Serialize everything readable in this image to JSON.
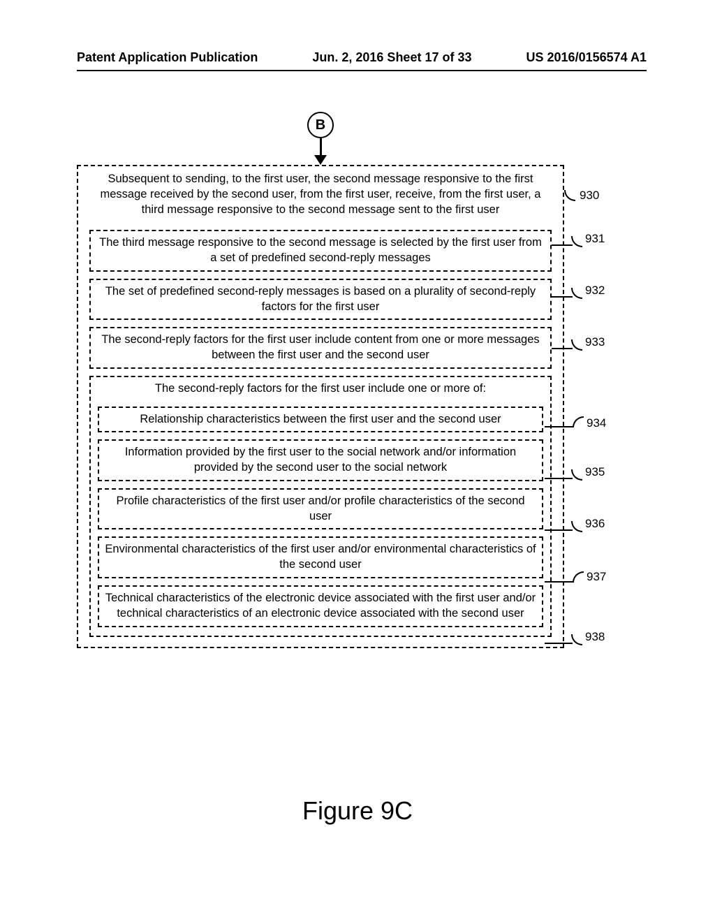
{
  "header": {
    "left": "Patent Application Publication",
    "center": "Jun. 2, 2016  Sheet 17 of 33",
    "right": "US 2016/0156574 A1"
  },
  "connector": {
    "label": "B"
  },
  "outer": {
    "text": "Subsequent to sending, to the first user, the second message responsive to the first message received by the second user, from the first user, receive, from the first user, a third message responsive to the second message sent to the first user",
    "ref": "930"
  },
  "inner": [
    {
      "text": "The third message responsive to the second message is selected by the first user from a set of predefined second-reply messages",
      "ref": "931"
    },
    {
      "text": "The set of predefined second-reply messages is based on a plurality of second-reply factors for the first user",
      "ref": "932"
    },
    {
      "text": "The second-reply factors for the first user include content from one or more messages between the first user and the second user",
      "ref": "933"
    }
  ],
  "group": {
    "title": "The second-reply factors for the first user include one or more of:",
    "items": [
      {
        "text": "Relationship characteristics between the first user and the second user",
        "ref": "934"
      },
      {
        "text": "Information provided by the first user to the social network and/or information provided by the second user to the social network",
        "ref": "935"
      },
      {
        "text": "Profile characteristics of the first user and/or profile characteristics of the second user",
        "ref": "936"
      },
      {
        "text": "Environmental characteristics of the first user and/or environmental characteristics of the second user",
        "ref": "937"
      },
      {
        "text": "Technical characteristics of the electronic device associated with the first user and/or technical characteristics of an electronic device associated with the second user",
        "ref": "938"
      }
    ]
  },
  "figure_caption": "Figure 9C"
}
